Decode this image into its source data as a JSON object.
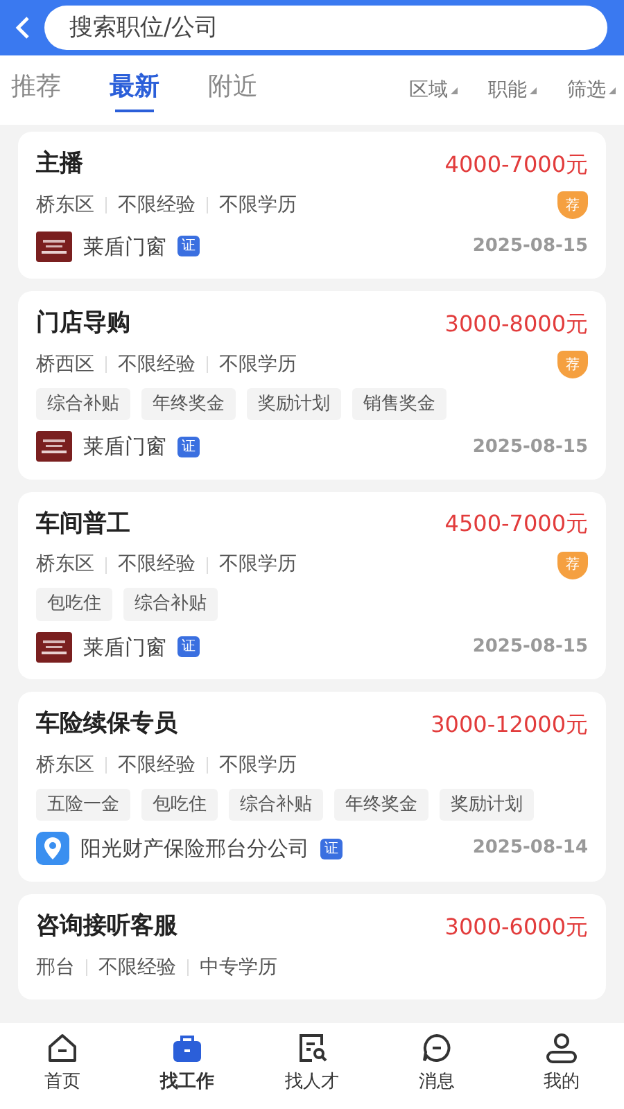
{
  "search": {
    "placeholder": "搜索职位/公司"
  },
  "tabs": [
    {
      "label": "推荐",
      "selected": false
    },
    {
      "label": "最新",
      "selected": true
    },
    {
      "label": "附近",
      "selected": false
    }
  ],
  "filters": [
    "区域",
    "职能",
    "筛选"
  ],
  "jobs": [
    {
      "title": "主播",
      "salary": "4000-7000元",
      "badge": "荐",
      "meta": [
        "桥东区",
        "不限经验",
        "不限学历"
      ],
      "company": "莱盾门窗",
      "kind": "maroon",
      "verified": "证",
      "date": "2025-08-15"
    },
    {
      "title": "门店导购",
      "salary": "3000-8000元",
      "badge": "荐",
      "meta": [
        "桥西区",
        "不限经验",
        "不限学历"
      ],
      "tags": [
        "综合补贴",
        "年终奖金",
        "奖励计划",
        "销售奖金"
      ],
      "company": "莱盾门窗",
      "kind": "maroon",
      "verified": "证",
      "date": "2025-08-15"
    },
    {
      "title": "车间普工",
      "salary": "4500-7000元",
      "badge": "荐",
      "meta": [
        "桥东区",
        "不限经验",
        "不限学历"
      ],
      "tags": [
        "包吃住",
        "综合补贴"
      ],
      "company": "莱盾门窗",
      "kind": "maroon",
      "verified": "证",
      "date": "2025-08-15"
    },
    {
      "title": "车险续保专员",
      "salary": "3000-12000元",
      "meta": [
        "桥东区",
        "不限经验",
        "不限学历"
      ],
      "tags": [
        "五险一金",
        "包吃住",
        "综合补贴",
        "年终奖金",
        "奖励计划"
      ],
      "company": "阳光财产保险邢台分公司",
      "kind": "pin",
      "verified": "证",
      "date": "2025-08-14"
    },
    {
      "title": "咨询接听客服",
      "salary": "3000-6000元",
      "meta": [
        "邢台",
        "不限经验",
        "中专学历"
      ]
    }
  ],
  "nav": [
    {
      "label": "首页",
      "kind": "home",
      "selected": false
    },
    {
      "label": "找工作",
      "kind": "briefcase",
      "selected": true
    },
    {
      "label": "找人才",
      "kind": "search-doc",
      "selected": false
    },
    {
      "label": "消息",
      "kind": "message",
      "selected": false
    },
    {
      "label": "我的",
      "kind": "person",
      "selected": false
    }
  ]
}
